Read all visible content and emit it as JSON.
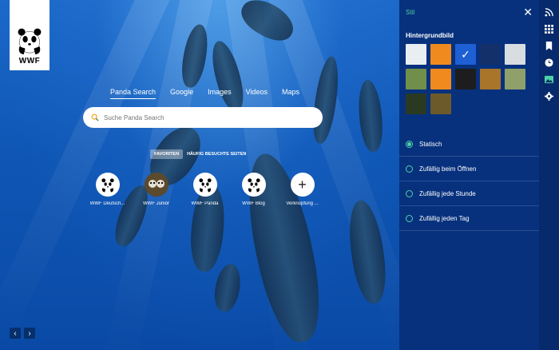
{
  "logo": {
    "text": "WWF"
  },
  "search": {
    "tabs": [
      "Panda Search",
      "Google",
      "Images",
      "Videos",
      "Maps"
    ],
    "active_tab": 0,
    "placeholder": "Suche Panda Search"
  },
  "sections": {
    "favorites": "FAVORITEN",
    "frequent": "HÄUFIG BESUCHTE SEITEN"
  },
  "shortcuts": [
    {
      "label": "WWF Deutsch...",
      "icon": "panda-icon"
    },
    {
      "label": "WWF Junior",
      "icon": "pandas-photo-icon"
    },
    {
      "label": "WWF Panda",
      "icon": "panda-icon"
    },
    {
      "label": "WWF Blog",
      "icon": "panda-icon"
    },
    {
      "label": "Verknüpfung ...",
      "icon": "plus-icon"
    }
  ],
  "panel": {
    "title": "Stil",
    "section_title": "Hintergrundbild",
    "thumbnails": [
      {
        "color": "#e9eef2",
        "selected": false
      },
      {
        "color": "#f08a1f",
        "selected": false
      },
      {
        "color": "#1e5fd3",
        "selected": true
      },
      {
        "color": "#14306a",
        "selected": false
      },
      {
        "color": "#d8dde2",
        "selected": false
      },
      {
        "color": "#6f8f4b",
        "selected": false
      },
      {
        "color": "#f08a1f",
        "selected": false
      },
      {
        "color": "#1d1d1d",
        "selected": false
      },
      {
        "color": "#a8752a",
        "selected": false
      },
      {
        "color": "#8fa06a",
        "selected": false
      },
      {
        "color": "#2a3a22",
        "selected": false
      },
      {
        "color": "#6d5a2a",
        "selected": false
      }
    ],
    "options": [
      {
        "label": "Statisch",
        "selected": true
      },
      {
        "label": "Zufällig beim Öffnen",
        "selected": false
      },
      {
        "label": "Zufällig jede Stunde",
        "selected": false
      },
      {
        "label": "Zufällig jeden Tag",
        "selected": false
      }
    ]
  },
  "colors": {
    "accent": "#4fd1a8",
    "panel_bg": "#07317d",
    "rail_bg": "#062a6b"
  }
}
